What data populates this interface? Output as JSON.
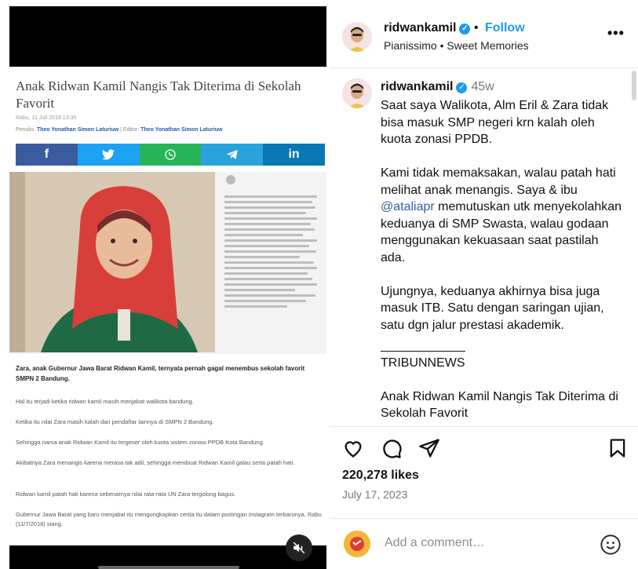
{
  "media": {
    "article": {
      "title": "Anak Ridwan Kamil Nangis Tak Diterima di Sekolah Favorit",
      "date": "Rabu, 11 Juli 2018 13:35",
      "byline_prefix": "Penulis:",
      "author": "Theo Yonathan Simon Laturiuw",
      "editor_prefix": "| Editor:",
      "editor": "Theo Yonathan Simon Laturiuw",
      "share": [
        {
          "icon": "facebook-icon",
          "glyph": "f"
        },
        {
          "icon": "twitter-icon",
          "glyph": "🐦"
        },
        {
          "icon": "whatsapp-icon",
          "glyph": "✆"
        },
        {
          "icon": "telegram-icon",
          "glyph": "➤"
        },
        {
          "icon": "linkedin-icon",
          "glyph": "in"
        }
      ],
      "lead": "Zara, anak Gubernur Jawa Barat Ridwan Kamil, ternyata pernah gagal menembus sekolah favorit SMPN 2 Bandung.",
      "paragraphs": [
        "Hal itu terjadi ketika ridwan kamil masih menjabat walikota bandung.",
        "Ketika itu nilai Zara masih kalah dari pendaftar lainnya di SMPN 2 Bandung.",
        "Sehingga nama anak Ridwan Kamil itu tergeser oleh kuota sistem zonasi PPDB Kota Bandung.",
        "Akibatnya Zara menangis karena merasa tak adil, sehingga membuat Ridwan Kamil galau serta patah hati.",
        "Ridwan kamil patah hati karena sebenarnya nilai rata-rata UN Zara tergolong bagus.",
        "Gubernur Jawa Barat yang baru menjabat itu mengungkapkan cerita itu dalam postingan instagram terbarunya, Rabu (11/7/2018) siang."
      ]
    }
  },
  "header": {
    "username": "ridwankamil",
    "follow": "Follow",
    "audio": "Pianissimo • Sweet Memories",
    "more": "•••"
  },
  "caption": {
    "username": "ridwankamil",
    "time": "45w",
    "p1": "Saat saya Walikota, Alm Eril & Zara tidak bisa masuk SMP negeri krn kalah oleh kuota zonasi PPDB.",
    "p2_before": "Kami tidak memaksakan, walau patah hati melihat anak menangis. Saya & ibu ",
    "p2_mention": "@ataliapr",
    "p2_after": " memutuskan utk menyekolahkan keduanya di SMP Swasta, walau godaan menggunakan kekuasaan saat pastilah ada.",
    "p3": "Ujungnya, keduanya akhirnya bisa juga masuk ITB. Satu dengan saringan ujian, satu dgn jalur prestasi akademik.",
    "source": "TRIBUNNEWS",
    "p4": "Anak Ridwan Kamil Nangis Tak Diterima di Sekolah Favorit"
  },
  "stats": {
    "likes": "220,278 likes",
    "date": "July 17, 2023"
  },
  "comment": {
    "placeholder": "Add a comment…"
  },
  "colors": {
    "accent": "#1d9bf0",
    "mention": "#375ba7"
  }
}
